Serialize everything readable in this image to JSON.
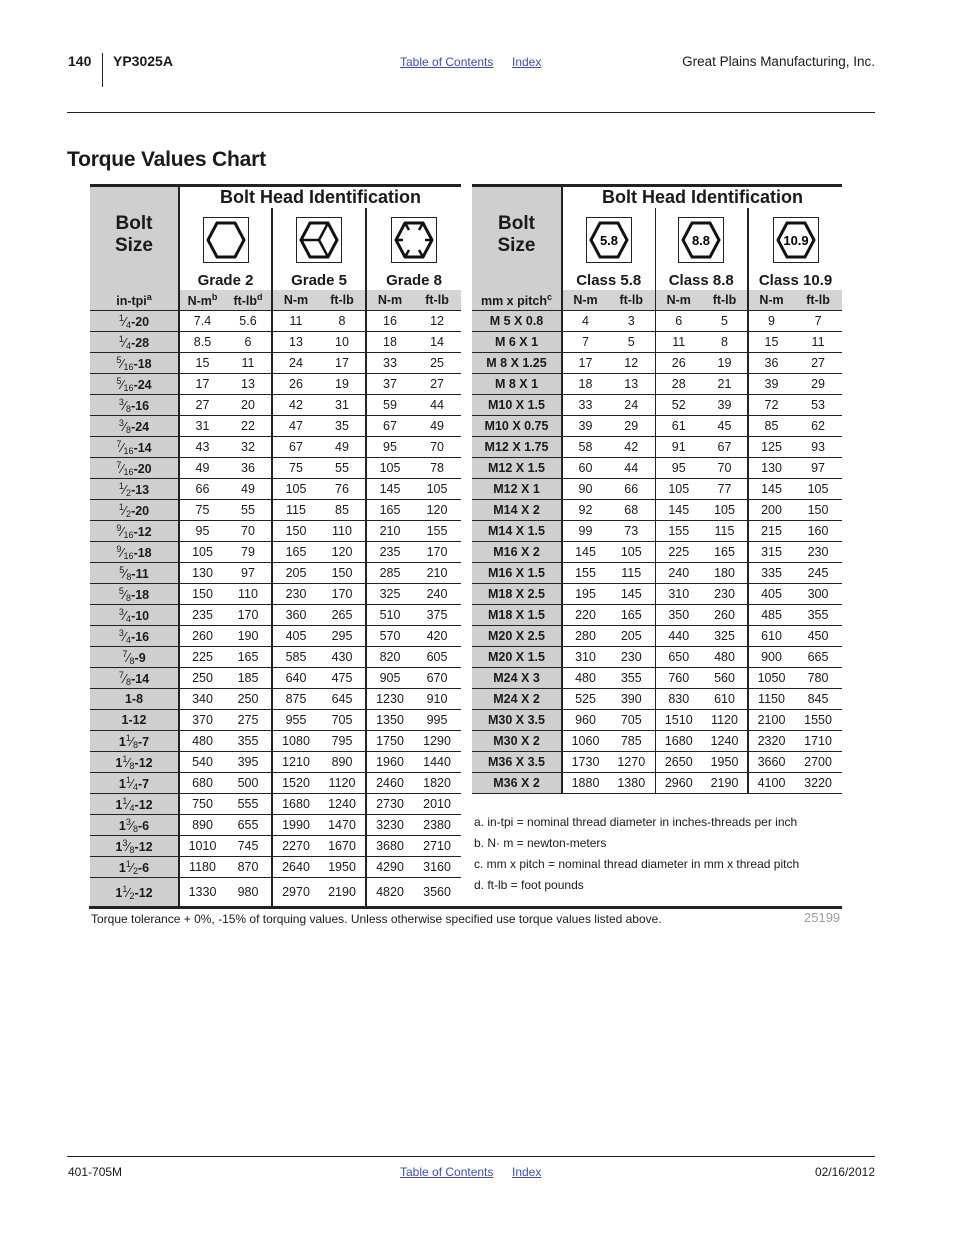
{
  "header": {
    "page_number": "140",
    "doc_title": "YP3025A",
    "links": [
      "Table of Contents",
      "Index"
    ],
    "company": "Great Plains Manufacturing, Inc."
  },
  "title": "Torque Values Chart",
  "inch_table": {
    "bolt_head_title": "Bolt Head Identification",
    "bolt_size_label_1": "Bolt",
    "bolt_size_label_2": "Size",
    "size_header": "in-tpi",
    "size_header_note": "a",
    "grades": [
      {
        "label": "Grade 2",
        "icon": "hexagon-plain-icon"
      },
      {
        "label": "Grade 5",
        "icon": "hexagon-three-lines-icon"
      },
      {
        "label": "Grade 8",
        "icon": "hexagon-six-lines-icon"
      }
    ],
    "units": [
      {
        "label": "N-m",
        "note": "b"
      },
      {
        "label": "ft-lb",
        "note": "d"
      },
      {
        "label": "N-m",
        "note": ""
      },
      {
        "label": "ft-lb",
        "note": ""
      },
      {
        "label": "N-m",
        "note": ""
      },
      {
        "label": "ft-lb",
        "note": ""
      }
    ],
    "rows": [
      {
        "whole": "",
        "num": "1",
        "den": "4",
        "tpi": "-20",
        "values": [
          "7.4",
          "5.6",
          "11",
          "8",
          "16",
          "12"
        ]
      },
      {
        "whole": "",
        "num": "1",
        "den": "4",
        "tpi": "-28",
        "values": [
          "8.5",
          "6",
          "13",
          "10",
          "18",
          "14"
        ]
      },
      {
        "whole": "",
        "num": "5",
        "den": "16",
        "tpi": "-18",
        "values": [
          "15",
          "11",
          "24",
          "17",
          "33",
          "25"
        ]
      },
      {
        "whole": "",
        "num": "5",
        "den": "16",
        "tpi": "-24",
        "values": [
          "17",
          "13",
          "26",
          "19",
          "37",
          "27"
        ]
      },
      {
        "whole": "",
        "num": "3",
        "den": "8",
        "tpi": "-16",
        "values": [
          "27",
          "20",
          "42",
          "31",
          "59",
          "44"
        ]
      },
      {
        "whole": "",
        "num": "3",
        "den": "8",
        "tpi": "-24",
        "values": [
          "31",
          "22",
          "47",
          "35",
          "67",
          "49"
        ]
      },
      {
        "whole": "",
        "num": "7",
        "den": "16",
        "tpi": "-14",
        "values": [
          "43",
          "32",
          "67",
          "49",
          "95",
          "70"
        ]
      },
      {
        "whole": "",
        "num": "7",
        "den": "16",
        "tpi": "-20",
        "values": [
          "49",
          "36",
          "75",
          "55",
          "105",
          "78"
        ]
      },
      {
        "whole": "",
        "num": "1",
        "den": "2",
        "tpi": "-13",
        "values": [
          "66",
          "49",
          "105",
          "76",
          "145",
          "105"
        ]
      },
      {
        "whole": "",
        "num": "1",
        "den": "2",
        "tpi": "-20",
        "values": [
          "75",
          "55",
          "115",
          "85",
          "165",
          "120"
        ]
      },
      {
        "whole": "",
        "num": "9",
        "den": "16",
        "tpi": "-12",
        "values": [
          "95",
          "70",
          "150",
          "110",
          "210",
          "155"
        ]
      },
      {
        "whole": "",
        "num": "9",
        "den": "16",
        "tpi": "-18",
        "values": [
          "105",
          "79",
          "165",
          "120",
          "235",
          "170"
        ]
      },
      {
        "whole": "",
        "num": "5",
        "den": "8",
        "tpi": "-11",
        "values": [
          "130",
          "97",
          "205",
          "150",
          "285",
          "210"
        ]
      },
      {
        "whole": "",
        "num": "5",
        "den": "8",
        "tpi": "-18",
        "values": [
          "150",
          "110",
          "230",
          "170",
          "325",
          "240"
        ]
      },
      {
        "whole": "",
        "num": "3",
        "den": "4",
        "tpi": "-10",
        "values": [
          "235",
          "170",
          "360",
          "265",
          "510",
          "375"
        ]
      },
      {
        "whole": "",
        "num": "3",
        "den": "4",
        "tpi": "-16",
        "values": [
          "260",
          "190",
          "405",
          "295",
          "570",
          "420"
        ]
      },
      {
        "whole": "",
        "num": "7",
        "den": "8",
        "tpi": "-9",
        "values": [
          "225",
          "165",
          "585",
          "430",
          "820",
          "605"
        ]
      },
      {
        "whole": "",
        "num": "7",
        "den": "8",
        "tpi": "-14",
        "values": [
          "250",
          "185",
          "640",
          "475",
          "905",
          "670"
        ]
      },
      {
        "whole": "1",
        "num": "",
        "den": "",
        "tpi": "-8",
        "values": [
          "340",
          "250",
          "875",
          "645",
          "1230",
          "910"
        ]
      },
      {
        "whole": "1",
        "num": "",
        "den": "",
        "tpi": "-12",
        "values": [
          "370",
          "275",
          "955",
          "705",
          "1350",
          "995"
        ]
      },
      {
        "whole": "1",
        "num": "1",
        "den": "8",
        "tpi": "-7",
        "values": [
          "480",
          "355",
          "1080",
          "795",
          "1750",
          "1290"
        ]
      },
      {
        "whole": "1",
        "num": "1",
        "den": "8",
        "tpi": "-12",
        "values": [
          "540",
          "395",
          "1210",
          "890",
          "1960",
          "1440"
        ]
      },
      {
        "whole": "1",
        "num": "1",
        "den": "4",
        "tpi": "-7",
        "values": [
          "680",
          "500",
          "1520",
          "1120",
          "2460",
          "1820"
        ]
      },
      {
        "whole": "1",
        "num": "1",
        "den": "4",
        "tpi": "-12",
        "values": [
          "750",
          "555",
          "1680",
          "1240",
          "2730",
          "2010"
        ]
      },
      {
        "whole": "1",
        "num": "3",
        "den": "8",
        "tpi": "-6",
        "values": [
          "890",
          "655",
          "1990",
          "1470",
          "3230",
          "2380"
        ]
      },
      {
        "whole": "1",
        "num": "3",
        "den": "8",
        "tpi": "-12",
        "values": [
          "1010",
          "745",
          "2270",
          "1670",
          "3680",
          "2710"
        ]
      },
      {
        "whole": "1",
        "num": "1",
        "den": "2",
        "tpi": "-6",
        "values": [
          "1180",
          "870",
          "2640",
          "1950",
          "4290",
          "3160"
        ]
      },
      {
        "whole": "1",
        "num": "1",
        "den": "2",
        "tpi": "-12",
        "values": [
          "1330",
          "980",
          "2970",
          "2190",
          "4820",
          "3560"
        ]
      }
    ]
  },
  "metric_table": {
    "bolt_head_title": "Bolt Head Identification",
    "bolt_size_label_1": "Bolt",
    "bolt_size_label_2": "Size",
    "size_header": "mm x pitch",
    "size_header_note": "c",
    "grades": [
      {
        "label": "Class 5.8",
        "icon": "hexagon-5-8-icon",
        "mark": "5.8"
      },
      {
        "label": "Class 8.8",
        "icon": "hexagon-8-8-icon",
        "mark": "8.8"
      },
      {
        "label": "Class 10.9",
        "icon": "hexagon-10-9-icon",
        "mark": "10.9"
      }
    ],
    "units": [
      "N-m",
      "ft-lb",
      "N-m",
      "ft-lb",
      "N-m",
      "ft-lb"
    ],
    "rows": [
      {
        "size": "M 5 X 0.8",
        "values": [
          "4",
          "3",
          "6",
          "5",
          "9",
          "7"
        ]
      },
      {
        "size": "M 6 X 1",
        "values": [
          "7",
          "5",
          "11",
          "8",
          "15",
          "11"
        ]
      },
      {
        "size": "M 8 X 1.25",
        "values": [
          "17",
          "12",
          "26",
          "19",
          "36",
          "27"
        ]
      },
      {
        "size": "M 8 X 1",
        "values": [
          "18",
          "13",
          "28",
          "21",
          "39",
          "29"
        ]
      },
      {
        "size": "M10 X 1.5",
        "values": [
          "33",
          "24",
          "52",
          "39",
          "72",
          "53"
        ]
      },
      {
        "size": "M10 X 0.75",
        "values": [
          "39",
          "29",
          "61",
          "45",
          "85",
          "62"
        ]
      },
      {
        "size": "M12 X 1.75",
        "values": [
          "58",
          "42",
          "91",
          "67",
          "125",
          "93"
        ]
      },
      {
        "size": "M12 X 1.5",
        "values": [
          "60",
          "44",
          "95",
          "70",
          "130",
          "97"
        ]
      },
      {
        "size": "M12 X 1",
        "values": [
          "90",
          "66",
          "105",
          "77",
          "145",
          "105"
        ]
      },
      {
        "size": "M14 X 2",
        "values": [
          "92",
          "68",
          "145",
          "105",
          "200",
          "150"
        ]
      },
      {
        "size": "M14 X 1.5",
        "values": [
          "99",
          "73",
          "155",
          "115",
          "215",
          "160"
        ]
      },
      {
        "size": "M16 X 2",
        "values": [
          "145",
          "105",
          "225",
          "165",
          "315",
          "230"
        ]
      },
      {
        "size": "M16 X 1.5",
        "values": [
          "155",
          "115",
          "240",
          "180",
          "335",
          "245"
        ]
      },
      {
        "size": "M18 X 2.5",
        "values": [
          "195",
          "145",
          "310",
          "230",
          "405",
          "300"
        ]
      },
      {
        "size": "M18 X 1.5",
        "values": [
          "220",
          "165",
          "350",
          "260",
          "485",
          "355"
        ]
      },
      {
        "size": "M20 X 2.5",
        "values": [
          "280",
          "205",
          "440",
          "325",
          "610",
          "450"
        ]
      },
      {
        "size": "M20 X 1.5",
        "values": [
          "310",
          "230",
          "650",
          "480",
          "900",
          "665"
        ]
      },
      {
        "size": "M24 X 3",
        "values": [
          "480",
          "355",
          "760",
          "560",
          "1050",
          "780"
        ]
      },
      {
        "size": "M24 X 2",
        "values": [
          "525",
          "390",
          "830",
          "610",
          "1150",
          "845"
        ]
      },
      {
        "size": "M30 X 3.5",
        "values": [
          "960",
          "705",
          "1510",
          "1120",
          "2100",
          "1550"
        ]
      },
      {
        "size": "M30 X 2",
        "values": [
          "1060",
          "785",
          "1680",
          "1240",
          "2320",
          "1710"
        ]
      },
      {
        "size": "M36 X 3.5",
        "values": [
          "1730",
          "1270",
          "2650",
          "1950",
          "3660",
          "2700"
        ]
      },
      {
        "size": "M36 X 2",
        "values": [
          "1880",
          "1380",
          "2960",
          "2190",
          "4100",
          "3220"
        ]
      }
    ]
  },
  "notes": [
    "a.  in-tpi = nominal thread diameter in inches-threads per inch",
    "b.  N· m = newton-meters",
    "c.  mm x pitch = nominal thread diameter in mm x thread  pitch",
    "d.  ft-lb = foot pounds"
  ],
  "tolerance_note": "Torque tolerance + 0%, -15% of torquing values. Unless otherwise specified use torque values listed above.",
  "figure_number": "25199",
  "footer": {
    "doc_number": "401-705M",
    "links": [
      "Table of Contents",
      "Index"
    ],
    "date": "02/16/2012"
  }
}
